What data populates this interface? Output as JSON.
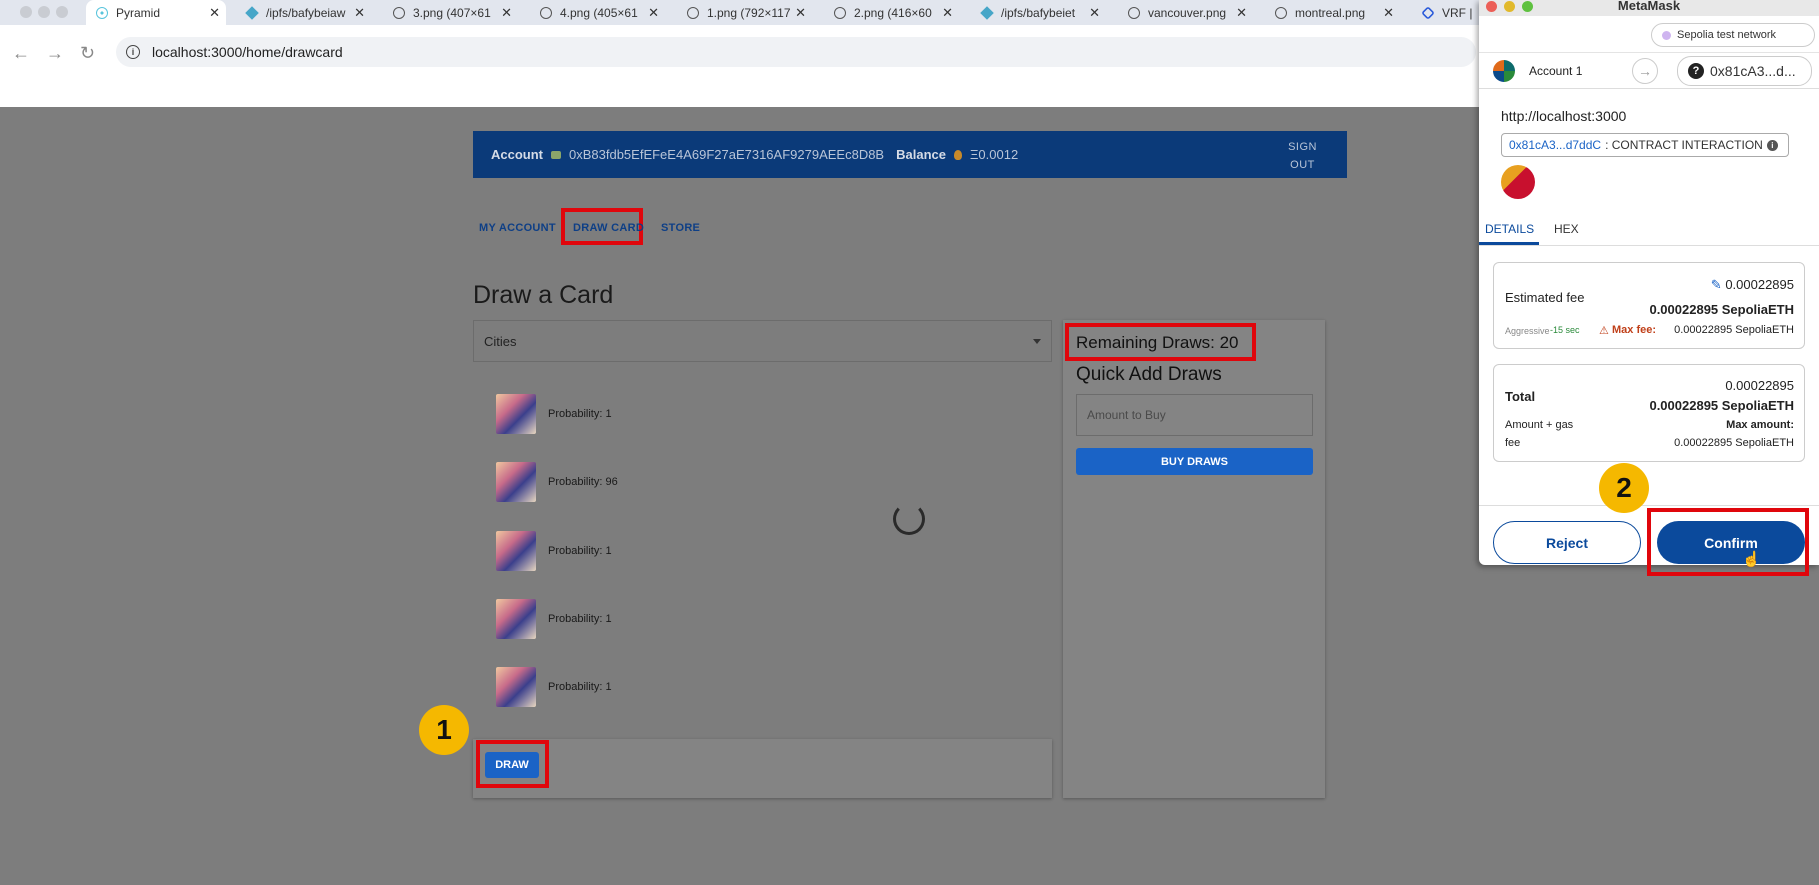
{
  "browser": {
    "tabs": [
      {
        "label": "Pyramid",
        "icon": "react-icon",
        "active": true
      },
      {
        "label": "/ipfs/bafybeiaw",
        "icon": "ipfs-icon"
      },
      {
        "label": "3.png (407×61",
        "icon": "globe-icon"
      },
      {
        "label": "4.png (405×61",
        "icon": "globe-icon"
      },
      {
        "label": "1.png (792×117",
        "icon": "globe-icon"
      },
      {
        "label": "2.png (416×60",
        "icon": "globe-icon"
      },
      {
        "label": "/ipfs/bafybeiet",
        "icon": "ipfs-icon"
      },
      {
        "label": "vancouver.png",
        "icon": "globe-icon"
      },
      {
        "label": "montreal.png",
        "icon": "globe-icon"
      },
      {
        "label": "VRF |",
        "icon": "chainlink-icon"
      }
    ],
    "close_glyph": "✕",
    "url": "localhost:3000/home/drawcard",
    "nav": {
      "back": "←",
      "forward": "→",
      "reload": "↻"
    }
  },
  "app": {
    "account_label": "Account",
    "account_address": "0xB83fdb5EfEFeE4A69F27aE7316AF9279AEEc8D8B",
    "balance_label": "Balance",
    "balance_value": "Ξ0.0012",
    "signout_line1": "SIGN",
    "signout_line2": "OUT",
    "nav": {
      "my_account": "MY ACCOUNT",
      "draw_card": "DRAW CARD",
      "store": "STORE"
    },
    "page_title": "Draw a Card",
    "select_value": "Cities",
    "cards": [
      {
        "probability": "Probability: 1"
      },
      {
        "probability": "Probability: 96"
      },
      {
        "probability": "Probability: 1"
      },
      {
        "probability": "Probability: 1"
      },
      {
        "probability": "Probability: 1"
      }
    ],
    "draw_button": "DRAW",
    "remaining_draws": "Remaining Draws: 20",
    "quick_add_title": "Quick Add Draws",
    "amount_placeholder": "Amount to Buy",
    "buy_button": "BUY DRAWS"
  },
  "annotations": {
    "step1": "1",
    "step2": "2"
  },
  "metamask": {
    "title": "MetaMask",
    "network": "Sepolia test network",
    "account": "Account 1",
    "to_address": "0x81cA3...d...",
    "origin": "http://localhost:3000",
    "contract_link": "0x81cA3...d7ddC",
    "contract_type": ": CONTRACT INTERACTION",
    "tabs": {
      "details": "DETAILS",
      "hex": "HEX"
    },
    "fee": {
      "label": "Estimated fee",
      "value_small": "0.00022895",
      "value_bold": "0.00022895 SepoliaETH",
      "speed": "Aggressive",
      "time": "-15 sec",
      "max_fee_label": "Max fee:",
      "max_fee_value": "0.00022895 SepoliaETH"
    },
    "total": {
      "label": "Total",
      "value_small": "0.00022895",
      "value_bold": "0.00022895 SepoliaETH",
      "amount_gas_line1": "Amount + gas",
      "amount_gas_line2": "fee",
      "max_amount_label": "Max amount:",
      "max_amount_value": "0.00022895 SepoliaETH"
    },
    "reject": "Reject",
    "confirm": "Confirm"
  },
  "colors": {
    "accent": "#1a63c6",
    "appbar": "#0b3a79",
    "highlight": "#e0060c",
    "badge": "#f5b800",
    "mm_primary": "#0b4a9c"
  }
}
